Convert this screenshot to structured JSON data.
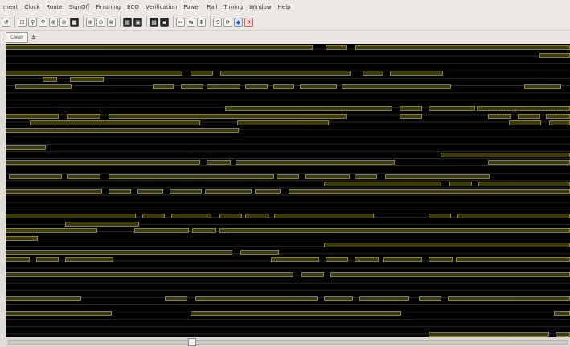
{
  "menu": [
    "ment",
    "Clock",
    "Route",
    "SignOff",
    "Finishing",
    "ECO",
    "Verification",
    "Power",
    "Rail",
    "Timing",
    "Window",
    "Help"
  ],
  "subtoolbar": {
    "clear_label": "Clear",
    "pin_glyph": "#"
  },
  "colors": {
    "wave_bg": "#000000",
    "bus_fill": "#3a3a16",
    "bus_stroke": "#c9c24a",
    "row_line": "#2a2a2a"
  },
  "toolbar_icons": [
    {
      "glyph": "↺",
      "name": "undo-icon"
    },
    {
      "glyph": "☐",
      "name": "view-icon"
    },
    {
      "glyph": "⚲",
      "name": "zoom-icon"
    },
    {
      "glyph": "⚲",
      "name": "zoom-out-icon"
    },
    {
      "glyph": "⊕",
      "name": "zoom-in-icon"
    },
    {
      "glyph": "⊖",
      "name": "zoom-fit-icon"
    },
    {
      "glyph": "■",
      "name": "select-icon"
    },
    {
      "glyph": "⊕",
      "name": "add-icon"
    },
    {
      "glyph": "⊖",
      "name": "remove-icon"
    },
    {
      "glyph": "⊗",
      "name": "clear-icon"
    },
    {
      "glyph": "▦",
      "name": "grid-icon"
    },
    {
      "glyph": "▣",
      "name": "layout-icon"
    },
    {
      "glyph": "▩",
      "name": "display-icon"
    },
    {
      "glyph": "▪",
      "name": "mark-icon"
    },
    {
      "glyph": "↔",
      "name": "expand-icon"
    },
    {
      "glyph": "⇆",
      "name": "shift-icon"
    },
    {
      "glyph": "↕",
      "name": "stretch-icon"
    },
    {
      "glyph": "⟲",
      "name": "refresh-icon"
    },
    {
      "glyph": "⟳",
      "name": "redo-icon"
    },
    {
      "glyph": "◆",
      "name": "marker-icon"
    },
    {
      "glyph": "✕",
      "name": "close-icon"
    }
  ]
}
